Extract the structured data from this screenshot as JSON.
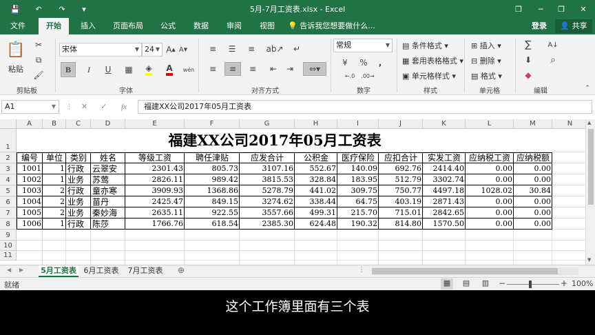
{
  "window": {
    "title": "5月-7月工资表.xlsx - Excel",
    "save_icon": "💾",
    "undo_icon": "↶",
    "redo_icon": "↷",
    "customize_icon": "▾",
    "restore_icon": "❐",
    "minimize_icon": "─",
    "maximize_icon": "❐",
    "close_icon": "✕"
  },
  "menu": {
    "tabs": [
      "文件",
      "开始",
      "插入",
      "页面布局",
      "公式",
      "数据",
      "审阅",
      "视图"
    ],
    "active_index": 1,
    "tell_me": "告诉我您想要做什么...",
    "login": "登录",
    "share": "共享"
  },
  "ribbon": {
    "clipboard": {
      "label": "剪贴板",
      "paste": "粘贴"
    },
    "font": {
      "label": "字体",
      "font_name": "宋体",
      "font_size": "24",
      "bold": "B",
      "italic": "I",
      "underline": "U",
      "phonetic": "wén"
    },
    "alignment": {
      "label": "对齐方式"
    },
    "number": {
      "label": "数字",
      "format": "常规",
      "currency": "¥",
      "percent": "%",
      "comma": ","
    },
    "styles": {
      "label": "样式",
      "conditional": "条件格式",
      "table": "套用表格格式",
      "cell_styles": "单元格样式"
    },
    "cells": {
      "label": "单元格",
      "insert": "插入",
      "delete": "删除",
      "format": "格式"
    },
    "editing": {
      "label": "编辑",
      "sum": "∑",
      "sort": "A↓",
      "find": "⌕",
      "clear": "◆"
    }
  },
  "formula_bar": {
    "name_box": "A1",
    "cancel": "✕",
    "confirm": "✓",
    "fx": "fx",
    "content": "福建XX公司2017年05月工资表"
  },
  "columns": [
    "A",
    "B",
    "C",
    "D",
    "E",
    "F",
    "G",
    "H",
    "I",
    "J",
    "K",
    "L",
    "M",
    "N"
  ],
  "rows": [
    "1",
    "2",
    "3",
    "4",
    "5",
    "6",
    "7",
    "8",
    "9",
    "10",
    "11"
  ],
  "sheet": {
    "title": "福建XX公司2017年05月工资表",
    "headers": [
      "编号",
      "单位",
      "类别",
      "姓名",
      "等级工资",
      "聘任津贴",
      "应发合计",
      "公积金",
      "医疗保险",
      "应扣合计",
      "实发工资",
      "应纳税工资",
      "应纳税额"
    ],
    "data": [
      [
        "1001",
        "1",
        "行政",
        "云翠安",
        "2301.43",
        "805.73",
        "3107.16",
        "552.67",
        "140.09",
        "692.76",
        "2414.40",
        "0.00",
        "0.00"
      ],
      [
        "1002",
        "1",
        "业务",
        "苏莺",
        "2826.11",
        "989.42",
        "3815.53",
        "328.84",
        "183.95",
        "512.79",
        "3302.74",
        "0.00",
        "0.00"
      ],
      [
        "1003",
        "2",
        "行政",
        "童亦寒",
        "3909.93",
        "1368.86",
        "5278.79",
        "441.02",
        "309.75",
        "750.77",
        "4497.18",
        "1028.02",
        "30.84"
      ],
      [
        "1004",
        "2",
        "业务",
        "苗丹",
        "2425.47",
        "849.15",
        "3274.62",
        "338.44",
        "64.75",
        "403.19",
        "2871.43",
        "0.00",
        "0.00"
      ],
      [
        "1005",
        "2",
        "业务",
        "秦妙海",
        "2635.11",
        "922.55",
        "3557.66",
        "499.31",
        "215.70",
        "715.01",
        "2842.65",
        "0.00",
        "0.00"
      ],
      [
        "1006",
        "1",
        "行政",
        "陈莎",
        "1766.76",
        "618.54",
        "2385.30",
        "624.48",
        "190.32",
        "814.80",
        "1570.50",
        "0.00",
        "0.00"
      ]
    ]
  },
  "sheet_tabs": [
    "5月工资表",
    "6月工资表",
    "7月工资表"
  ],
  "active_sheet": 0,
  "add_sheet": "⊕",
  "status": {
    "ready": "就绪",
    "zoom": "100%",
    "zoom_out": "−",
    "zoom_in": "+"
  },
  "subtitle": "这个工作簿里面有三个表"
}
